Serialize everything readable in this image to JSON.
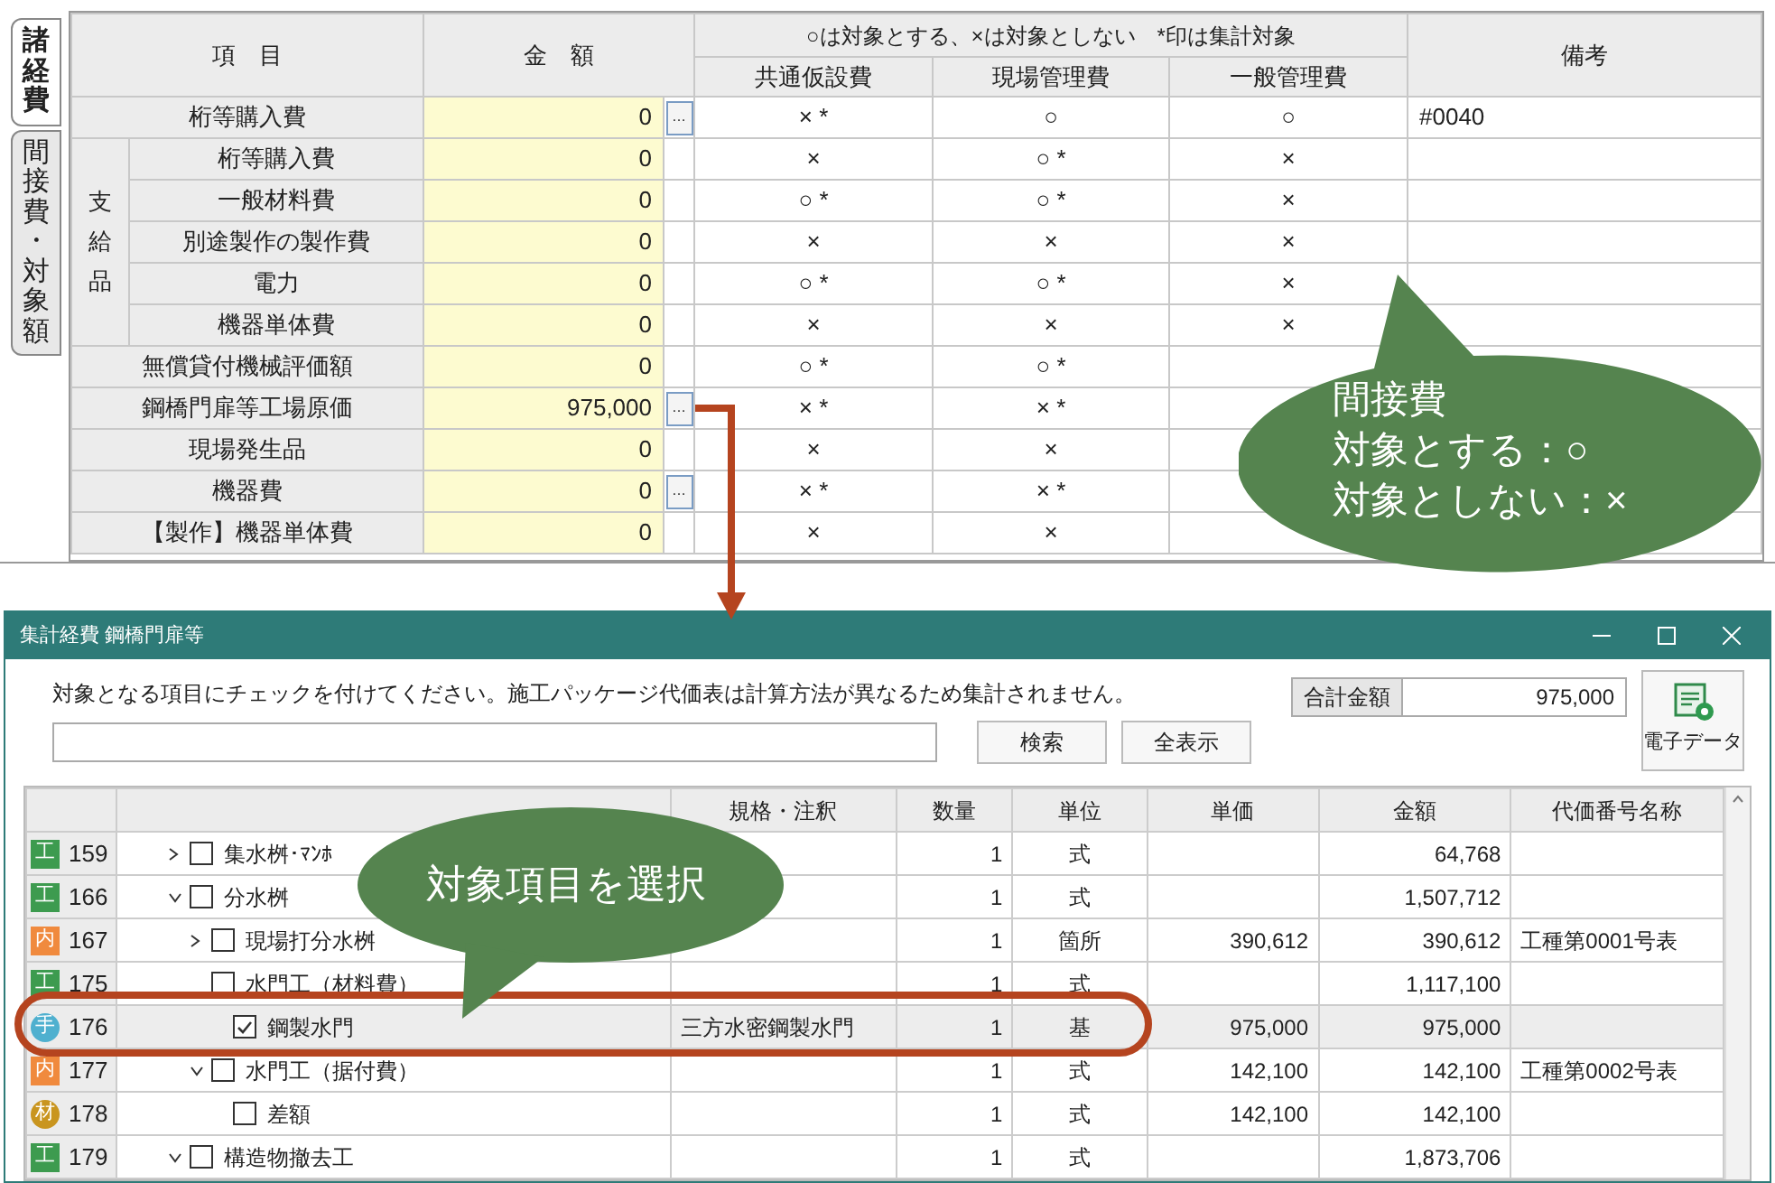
{
  "top_panel": {
    "tabs": [
      {
        "label": "諸経費",
        "selected": true
      },
      {
        "label": "間接費・対象額",
        "selected": false
      }
    ],
    "header": {
      "item": "項　目",
      "amount": "金　額",
      "legend": "○は対象とする、×は対象としない　*印は集計対象",
      "columns": [
        "共通仮設費",
        "現場管理費",
        "一般管理費"
      ],
      "remarks": "備考"
    },
    "rows": [
      {
        "kind": "item",
        "label": "桁等購入費",
        "amount": "0",
        "button": "…",
        "marks": [
          "× *",
          "○",
          "○"
        ],
        "remarks": "#0040"
      },
      {
        "kind": "group",
        "label": "支給品",
        "children": [
          {
            "label": "桁等購入費",
            "amount": "0",
            "marks": [
              "×",
              "○ *",
              "×"
            ]
          },
          {
            "label": "一般材料費",
            "amount": "0",
            "marks": [
              "○ *",
              "○ *",
              "×"
            ]
          },
          {
            "label": "別途製作の製作費",
            "amount": "0",
            "marks": [
              "×",
              "×",
              "×"
            ]
          },
          {
            "label": "電力",
            "amount": "0",
            "marks": [
              "○ *",
              "○ *",
              "×"
            ]
          },
          {
            "label": "機器単体費",
            "amount": "0",
            "marks": [
              "×",
              "×",
              "×"
            ]
          }
        ]
      },
      {
        "kind": "item",
        "label": "無償貸付機械評価額",
        "amount": "0",
        "marks": [
          "○ *",
          "○ *"
        ]
      },
      {
        "kind": "item",
        "label": "鋼橋門扉等工場原価",
        "amount": "975,000",
        "button": "…",
        "marks": [
          "× *",
          "× *"
        ]
      },
      {
        "kind": "item",
        "label": "現場発生品",
        "amount": "0",
        "marks": [
          "×",
          "×"
        ]
      },
      {
        "kind": "item",
        "label": "機器費",
        "amount": "0",
        "button": "…",
        "marks": [
          "× *",
          "× *"
        ]
      },
      {
        "kind": "item",
        "label": "【製作】機器単体費",
        "amount": "0",
        "marks": [
          "×",
          "×"
        ]
      }
    ]
  },
  "callout_top": {
    "lines": [
      "間接費",
      "対象とする：○",
      "対象としない：×"
    ]
  },
  "window": {
    "title": "集計経費 鋼橋門扉等",
    "instruction": "対象となる項目にチェックを付けてください。施工パッケージ代価表は計算方法が異なるため集計されません。",
    "total_label": "合計金額",
    "total_value": "975,000",
    "search_buttons": [
      "検索",
      "全表示"
    ],
    "data_button": "電子データ",
    "table": {
      "columns": [
        "規格・注釈",
        "数量",
        "単位",
        "単価",
        "金額",
        "代価番号名称"
      ],
      "rows": [
        {
          "badge": "工",
          "kind": "square",
          "color": "#3d9b4f",
          "no": "159",
          "expanded": false,
          "checked": false,
          "selected": false,
          "name": "集水桝･ﾏﾝﾎ",
          "qty": "1",
          "unit": "式",
          "amount": "64,768"
        },
        {
          "badge": "工",
          "kind": "square",
          "color": "#3d9b4f",
          "no": "166",
          "expanded": true,
          "checked": false,
          "selected": false,
          "name": "分水桝",
          "qty": "1",
          "unit": "式",
          "amount": "1,507,712",
          "children": [
            {
              "badge": "内",
              "kind": "square",
              "color": "#f08a3e",
              "no": "167",
              "expanded": false,
              "checked": false,
              "selected": false,
              "name": "現場打分水桝",
              "qty": "1",
              "unit": "箇所",
              "unit_price": "390,612",
              "amount": "390,612",
              "code": "工種第0001号表"
            },
            {
              "badge": "工",
              "kind": "square",
              "color": "#3d9b4f",
              "no": "175",
              "checked": false,
              "selected": false,
              "name": "水門工（材料費）",
              "qty": "1",
              "unit": "式",
              "amount": "1,117,100",
              "children": [
                {
                  "badge": "手",
                  "kind": "circle",
                  "color": "#4fb0cf",
                  "no": "176",
                  "checked": true,
                  "selected": true,
                  "name": "鋼製水門",
                  "spec": "三方水密鋼製水門",
                  "qty": "1",
                  "unit": "基",
                  "unit_price": "975,000",
                  "amount": "975,000"
                }
              ]
            },
            {
              "badge": "内",
              "kind": "square",
              "color": "#f08a3e",
              "no": "177",
              "expanded": true,
              "checked": false,
              "selected": false,
              "name": "水門工（据付費）",
              "qty": "1",
              "unit": "式",
              "unit_price": "142,100",
              "amount": "142,100",
              "code": "工種第0002号表",
              "children": [
                {
                  "badge": "材",
                  "kind": "circle",
                  "color": "#c9951f",
                  "no": "178",
                  "checked": false,
                  "selected": false,
                  "name": "差額",
                  "qty": "1",
                  "unit": "式",
                  "unit_price": "142,100",
                  "amount": "142,100"
                }
              ]
            }
          ]
        },
        {
          "badge": "工",
          "kind": "square",
          "color": "#3d9b4f",
          "no": "179",
          "expanded": true,
          "checked": false,
          "selected": false,
          "name": "構造物撤去工",
          "qty": "1",
          "unit": "式",
          "amount": "1,873,706"
        }
      ]
    }
  },
  "callout_bottom": {
    "text": "対象項目を選択"
  }
}
